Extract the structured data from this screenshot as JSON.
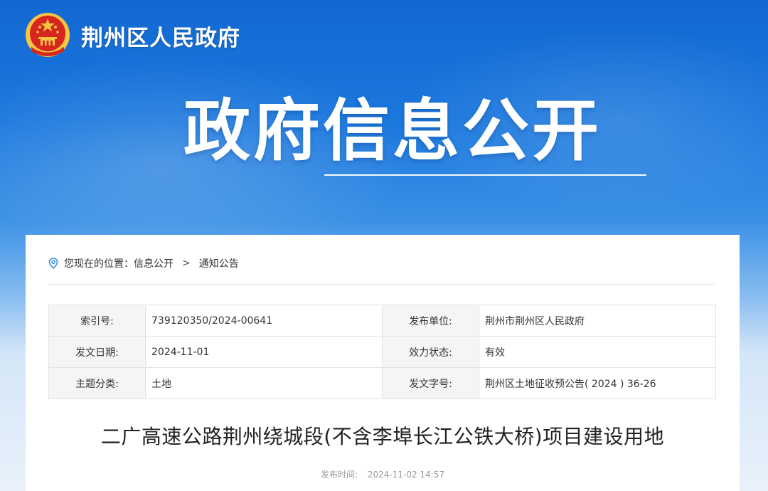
{
  "site": {
    "name": "荆州区人民政府"
  },
  "hero": {
    "title": "政府信息公开"
  },
  "breadcrumb": {
    "prefix": "您现在的位置：",
    "items": [
      "信息公开",
      "通知公告"
    ],
    "separator": ">"
  },
  "info": {
    "rows": [
      {
        "label_left": "索引号:",
        "value_left": "739120350/2024-00641",
        "label_right": "发布单位:",
        "value_right": "荆州市荆州区人民政府"
      },
      {
        "label_left": "发文日期:",
        "value_left": "2024-11-01",
        "label_right": "效力状态:",
        "value_right": "有效"
      },
      {
        "label_left": "主题分类:",
        "value_left": "土地",
        "label_right": "发文字号:",
        "value_right": "荆州区土地征收预公告( 2024 ) 36-26"
      }
    ]
  },
  "document": {
    "title": "二广高速公路荆州绕城段(不含李埠长江公铁大桥)项目建设用地",
    "publish_label": "发布时间:",
    "publish_time": "2024-11-02 14:57"
  },
  "colors": {
    "brand_blue": "#1268d2",
    "emblem_red": "#d7261e",
    "emblem_gold": "#f6c544"
  }
}
